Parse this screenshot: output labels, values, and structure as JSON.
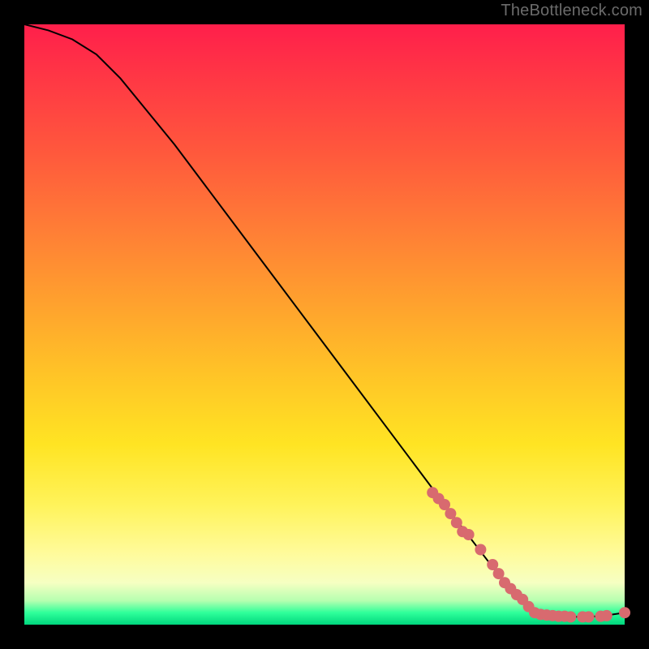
{
  "watermark": "TheBottleneck.com",
  "colors": {
    "curve_stroke": "#000000",
    "marker_fill": "#d86a6f",
    "marker_stroke": "#c95a60"
  },
  "chart_data": {
    "type": "line",
    "title": "",
    "xlabel": "",
    "ylabel": "",
    "xlim": [
      0,
      100
    ],
    "ylim": [
      0,
      100
    ],
    "curve": [
      {
        "x": 0,
        "y": 100
      },
      {
        "x": 4,
        "y": 99
      },
      {
        "x": 8,
        "y": 97.5
      },
      {
        "x": 12,
        "y": 95
      },
      {
        "x": 16,
        "y": 91
      },
      {
        "x": 25,
        "y": 80
      },
      {
        "x": 40,
        "y": 60
      },
      {
        "x": 55,
        "y": 40
      },
      {
        "x": 70,
        "y": 20
      },
      {
        "x": 80,
        "y": 7
      },
      {
        "x": 85,
        "y": 2
      },
      {
        "x": 88,
        "y": 1.5
      },
      {
        "x": 92,
        "y": 1.3
      },
      {
        "x": 96,
        "y": 1.4
      },
      {
        "x": 100,
        "y": 2
      }
    ],
    "markers": [
      {
        "x": 68,
        "y": 22
      },
      {
        "x": 69,
        "y": 21
      },
      {
        "x": 70,
        "y": 20
      },
      {
        "x": 71,
        "y": 18.5
      },
      {
        "x": 72,
        "y": 17
      },
      {
        "x": 73,
        "y": 15.5
      },
      {
        "x": 74,
        "y": 15
      },
      {
        "x": 76,
        "y": 12.5
      },
      {
        "x": 78,
        "y": 10
      },
      {
        "x": 79,
        "y": 8.5
      },
      {
        "x": 80,
        "y": 7
      },
      {
        "x": 81,
        "y": 6
      },
      {
        "x": 82,
        "y": 5
      },
      {
        "x": 83,
        "y": 4.2
      },
      {
        "x": 84,
        "y": 3
      },
      {
        "x": 85,
        "y": 2
      },
      {
        "x": 86,
        "y": 1.7
      },
      {
        "x": 87,
        "y": 1.6
      },
      {
        "x": 88,
        "y": 1.5
      },
      {
        "x": 89,
        "y": 1.4
      },
      {
        "x": 90,
        "y": 1.4
      },
      {
        "x": 91,
        "y": 1.3
      },
      {
        "x": 93,
        "y": 1.3
      },
      {
        "x": 94,
        "y": 1.3
      },
      {
        "x": 96,
        "y": 1.4
      },
      {
        "x": 97,
        "y": 1.5
      },
      {
        "x": 100,
        "y": 2
      }
    ]
  }
}
